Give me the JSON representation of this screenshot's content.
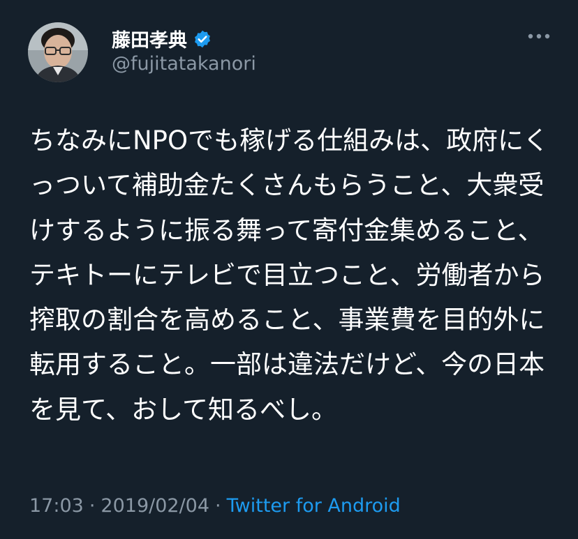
{
  "author": {
    "display_name": "藤田孝典",
    "handle": "@fujitatakanori",
    "verified": true,
    "avatar_icon": "profile-photo"
  },
  "more_icon": "more-horizontal-icon",
  "tweet": {
    "text": "ちなみにNPOでも稼げる仕組みは、政府にくっついて補助金たくさんもらうこと、大衆受けするように振る舞って寄付金集めること、テキトーにテレビで目立つこと、労働者から搾取の割合を高めること、事業費を目的外に転用すること。一部は違法だけど、今の日本を見て、おして知るべし。"
  },
  "meta": {
    "time": "17:03",
    "separator": "·",
    "date": "2019/02/04",
    "source": "Twitter for Android"
  },
  "colors": {
    "background": "#15202b",
    "text": "#ffffff",
    "secondary": "#8b98a5",
    "link": "#1d9bf0",
    "verified": "#1d9bf0"
  }
}
